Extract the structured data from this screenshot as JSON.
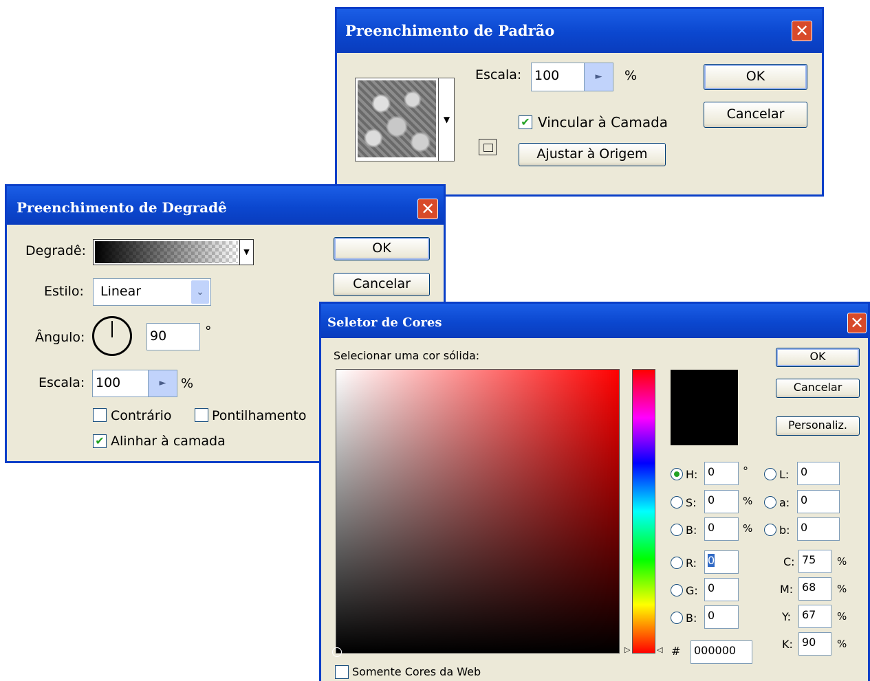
{
  "pattern_dialog": {
    "title": "Preenchimento de Padrão",
    "close_glyph": "✕",
    "scale_label": "Escala:",
    "scale_value": "100",
    "scale_unit": "%",
    "link_layer_label": "Vincular à Camada",
    "link_layer_checked": true,
    "snap_origin_label": "Ajustar à Origem",
    "ok_label": "OK",
    "cancel_label": "Cancelar"
  },
  "gradient_dialog": {
    "title": "Preenchimento de Degradê",
    "close_glyph": "✕",
    "gradient_label": "Degradê:",
    "style_label": "Estilo:",
    "style_value": "Linear",
    "angle_label": "Ângulo:",
    "angle_value": "90",
    "angle_unit": "°",
    "scale_label": "Escala:",
    "scale_value": "100",
    "scale_unit": "%",
    "reverse_label": "Contrário",
    "reverse_checked": false,
    "dither_label": "Pontilhamento",
    "dither_checked": false,
    "align_label": "Alinhar à camada",
    "align_checked": true,
    "ok_label": "OK",
    "cancel_label": "Cancelar"
  },
  "color_picker": {
    "title": "Seletor de Cores",
    "close_glyph": "✕",
    "prompt": "Selecionar uma cor sólida:",
    "ok_label": "OK",
    "cancel_label": "Cancelar",
    "custom_label": "Personaliz.",
    "selected_color": "#000000",
    "fields": {
      "h": {
        "label": "H:",
        "value": "0",
        "unit": "°",
        "selected": true
      },
      "s": {
        "label": "S:",
        "value": "0",
        "unit": "%"
      },
      "b": {
        "label": "B:",
        "value": "0",
        "unit": "%"
      },
      "r": {
        "label": "R:",
        "value": "0"
      },
      "g": {
        "label": "G:",
        "value": "0"
      },
      "bl": {
        "label": "B:",
        "value": "0"
      },
      "l": {
        "label": "L:",
        "value": "0"
      },
      "a": {
        "label": "a:",
        "value": "0"
      },
      "lab_b": {
        "label": "b:",
        "value": "0"
      },
      "c": {
        "label": "C:",
        "value": "75",
        "unit": "%"
      },
      "m": {
        "label": "M:",
        "value": "68",
        "unit": "%"
      },
      "y": {
        "label": "Y:",
        "value": "67",
        "unit": "%"
      },
      "k": {
        "label": "K:",
        "value": "90",
        "unit": "%"
      }
    },
    "hex_label": "#",
    "hex_value": "000000",
    "web_only_label": "Somente Cores da Web",
    "web_only_checked": false
  }
}
